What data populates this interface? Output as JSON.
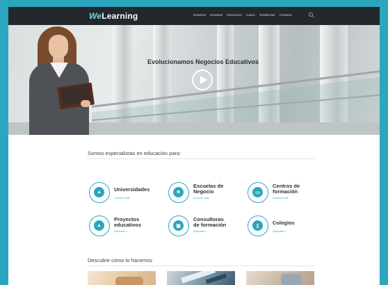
{
  "header": {
    "logo_prefix": "We",
    "logo_suffix": "Learning",
    "nav": [
      "Nosotros",
      "Nuestras",
      "Soluciones",
      "Casos",
      "Tendencias",
      "Contacto"
    ]
  },
  "hero": {
    "title": "Evolucionamos Negocios Educativos"
  },
  "specialists": {
    "title": "Somos especialistas en educación para:",
    "cards": [
      {
        "name_line1": "Universidades",
        "name_line2": "",
        "link": "Conocer más"
      },
      {
        "name_line1": "Escuelas de",
        "name_line2": "Negocio",
        "link": "Conocer más"
      },
      {
        "name_line1": "Centros de",
        "name_line2": "formación",
        "link": "Conocer más"
      },
      {
        "name_line1": "Proyectos",
        "name_line2": "educativos",
        "link": "Descubre +"
      },
      {
        "name_line1": "Consultoras",
        "name_line2": "de formación",
        "link": "Descubre +"
      },
      {
        "name_line1": "Colegios",
        "name_line2": "",
        "link": "Descubre +"
      }
    ]
  },
  "how": {
    "title": "Descubre cómo lo hacemos"
  },
  "colors": {
    "accent": "#2aa6be",
    "nav_bg": "#22282c"
  },
  "icons": [
    "graduation-cap-icon",
    "briefcase-icon",
    "monitor-icon",
    "graduation-cap-icon",
    "presentation-icon",
    "document-icon",
    "search-icon",
    "play-icon"
  ]
}
